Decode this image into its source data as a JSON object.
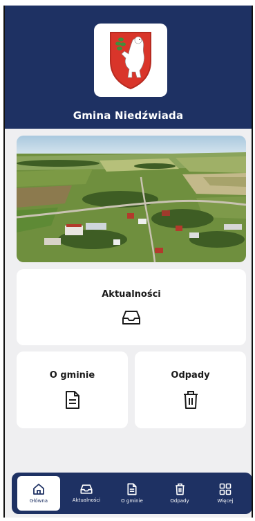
{
  "header": {
    "title": "Gmina Niedźwiada",
    "logo_icon": "coat-of-arms-bear-icon"
  },
  "hero": {
    "image": "aerial-village-photo"
  },
  "tiles": {
    "news": {
      "label": "Aktualności",
      "icon": "inbox-icon"
    },
    "about": {
      "label": "O gminie",
      "icon": "document-icon"
    },
    "waste": {
      "label": "Odpady",
      "icon": "trash-icon"
    }
  },
  "bottom_nav": {
    "items": [
      {
        "label": "Główna",
        "icon": "home-icon",
        "active": true
      },
      {
        "label": "Aktualności",
        "icon": "inbox-icon",
        "active": false
      },
      {
        "label": "O gminie",
        "icon": "document-icon",
        "active": false
      },
      {
        "label": "Odpady",
        "icon": "trash-icon",
        "active": false
      },
      {
        "label": "Więcej",
        "icon": "grid-icon",
        "active": false
      }
    ]
  },
  "colors": {
    "primary": "#1e3163",
    "background": "#efeff1",
    "card": "#ffffff",
    "shield_red": "#d9352a"
  }
}
